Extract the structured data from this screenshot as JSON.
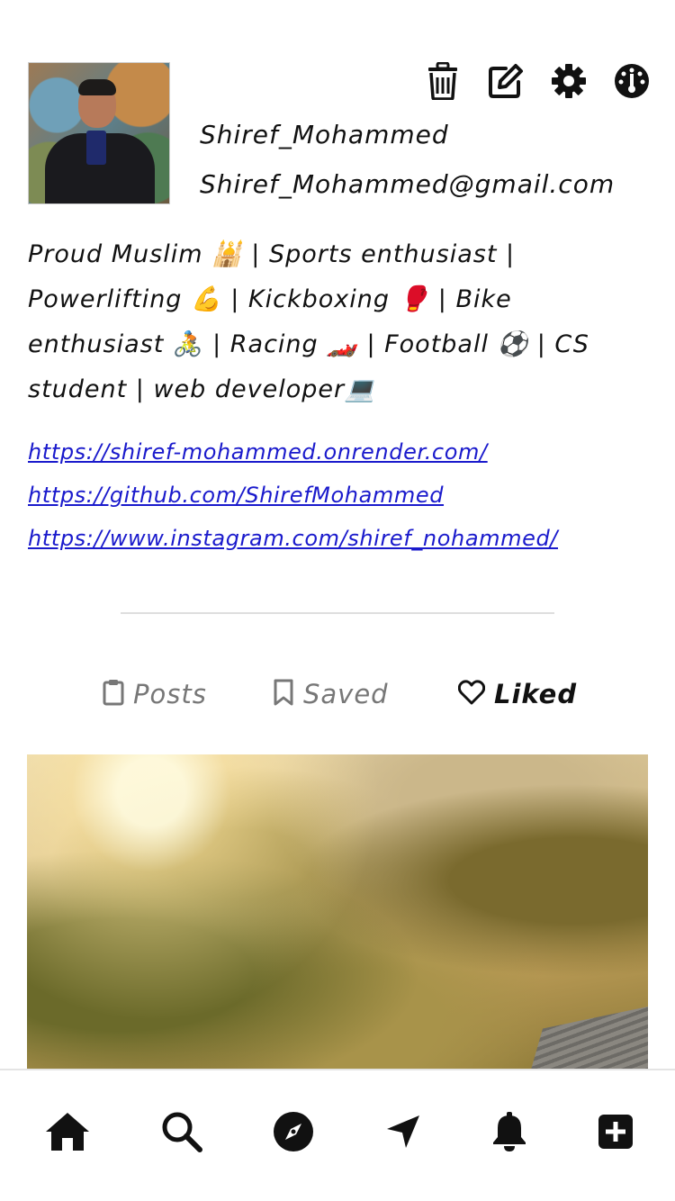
{
  "profile": {
    "username": "Shiref_Mohammed",
    "email": "Shiref_Mohammed@gmail.com",
    "bio": "Proud Muslim 🕌 | Sports enthusiast | Powerlifting 💪 | Kickboxing 🥊 | Bike enthusiast 🚴 | Racing 🏎️ | Football ⚽ | CS student | web developer💻",
    "links": [
      "https://shiref-mohammed.onrender.com/",
      "https://github.com/ShirefMohammed",
      "https://www.instagram.com/shiref_nohammed/"
    ]
  },
  "toolbar_icons": [
    "trash-icon",
    "edit-icon",
    "gear-icon",
    "dashboard-icon"
  ],
  "tabs": [
    {
      "label": "Posts",
      "icon": "clipboard-icon",
      "active": false
    },
    {
      "label": "Saved",
      "icon": "bookmark-icon",
      "active": false
    },
    {
      "label": "Liked",
      "icon": "heart-icon",
      "active": true
    }
  ],
  "bottom_nav": [
    "home-icon",
    "search-icon",
    "compass-icon",
    "location-arrow-icon",
    "bell-icon",
    "plus-square-icon"
  ],
  "colors": {
    "link": "#1a1acc",
    "text": "#111111",
    "inactive_tab": "#777777"
  }
}
